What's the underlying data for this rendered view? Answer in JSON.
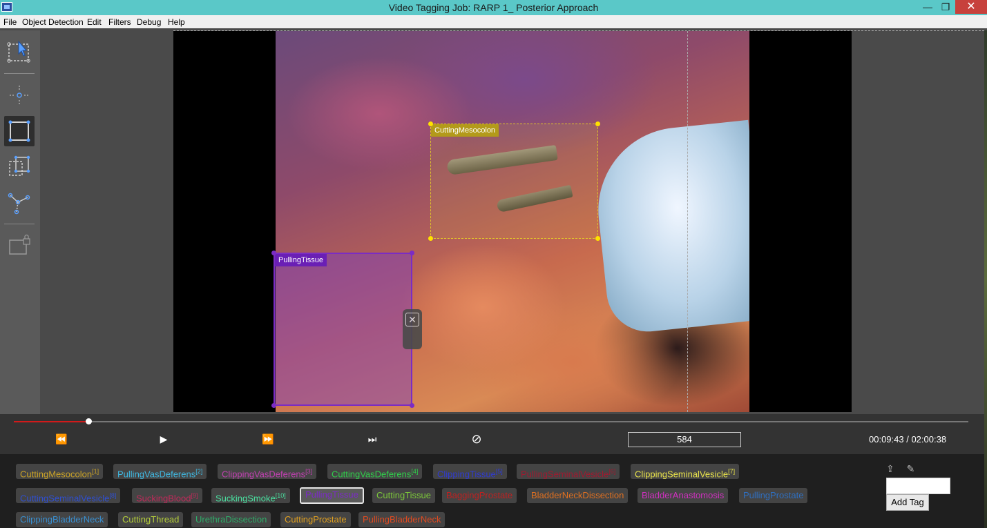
{
  "window": {
    "title": "Video Tagging Job: RARP 1_ Posterior Approach",
    "minimize_glyph": "—",
    "maximize_glyph": "❐",
    "close_glyph": "✕"
  },
  "menu": [
    "File",
    "Object Detection",
    "Edit",
    "Filters",
    "Debug",
    "Help"
  ],
  "toolbar": {
    "tools": [
      {
        "name": "select-tool",
        "icon": "pointer-select-icon",
        "active": false
      },
      {
        "name": "point-tool",
        "icon": "point-crosshair-icon",
        "active": false
      },
      {
        "name": "rectangle-tool",
        "icon": "rectangle-icon",
        "active": true
      },
      {
        "name": "copy-rectangle-tool",
        "icon": "copy-rectangle-icon",
        "active": false
      },
      {
        "name": "polygon-tool",
        "icon": "polygon-icon",
        "active": false
      },
      {
        "name": "lock-tool",
        "icon": "lock-icon",
        "active": false
      }
    ]
  },
  "regions": [
    {
      "label": "CuttingMesocolon",
      "color": "#e0c42a"
    },
    {
      "label": "PullingTissue",
      "color": "#7b2cc4"
    }
  ],
  "playback": {
    "progress": 0.0783,
    "rewind_glyph": "⏪",
    "play_glyph": "▶",
    "forward_glyph": "⏩",
    "next_frame_glyph": "⏭",
    "clear_glyph": "⊘",
    "frame": "584",
    "timecode": "00:09:43 / 02:00:38"
  },
  "tags": [
    {
      "label": "CuttingMesocolon",
      "hotkey": "[1]",
      "color": "#c9a227"
    },
    {
      "label": "PullingVasDeferens",
      "hotkey": "[2]",
      "color": "#3fb7e0"
    },
    {
      "label": "ClippingVasDeferens",
      "hotkey": "[3]",
      "color": "#c040b0"
    },
    {
      "label": "CuttingVasDeferens",
      "hotkey": "[4]",
      "color": "#2fce4a"
    },
    {
      "label": "ClippingTissue",
      "hotkey": "[5]",
      "color": "#2f3bd0"
    },
    {
      "label": "PullingSeminalVesicle",
      "hotkey": "[6]",
      "color": "#a01a30"
    },
    {
      "label": "ClippingSeminalVesicle",
      "hotkey": "[7]",
      "color": "#e8e24a"
    },
    {
      "label": "CuttingSeminalVesicle",
      "hotkey": "[8]",
      "color": "#2f4fd0"
    },
    {
      "label": "SuckingBlood",
      "hotkey": "[9]",
      "color": "#c02a5a"
    },
    {
      "label": "SuckingSmoke",
      "hotkey": "[10]",
      "color": "#4ae0a0"
    },
    {
      "label": "PullingTissue",
      "hotkey": "",
      "color": "#7b2cc4",
      "selected": true
    },
    {
      "label": "CuttingTissue",
      "hotkey": "",
      "color": "#7cc83a"
    },
    {
      "label": "BaggingProstate",
      "hotkey": "",
      "color": "#c02020"
    },
    {
      "label": "BladderNeckDissection",
      "hotkey": "",
      "color": "#e07020"
    },
    {
      "label": "BladderAnastomosis",
      "hotkey": "",
      "color": "#d030c0"
    },
    {
      "label": "PullingProstate",
      "hotkey": "",
      "color": "#2f6fc0"
    },
    {
      "label": "ClippingBladderNeck",
      "hotkey": "",
      "color": "#3a8fd0"
    },
    {
      "label": "CuttingThread",
      "hotkey": "",
      "color": "#b6d03a"
    },
    {
      "label": "UrethraDissection",
      "hotkey": "",
      "color": "#2fae6a"
    },
    {
      "label": "CuttingProstate",
      "hotkey": "",
      "color": "#e0a020"
    },
    {
      "label": "PullingBladderNeck",
      "hotkey": "",
      "color": "#e04a20"
    }
  ],
  "tag_tools": {
    "export_icon": "export-icon",
    "export_glyph": "⇪",
    "pin_icon": "pin-icon",
    "pin_glyph": "✎",
    "input_value": "",
    "add_label": "Add Tag"
  }
}
